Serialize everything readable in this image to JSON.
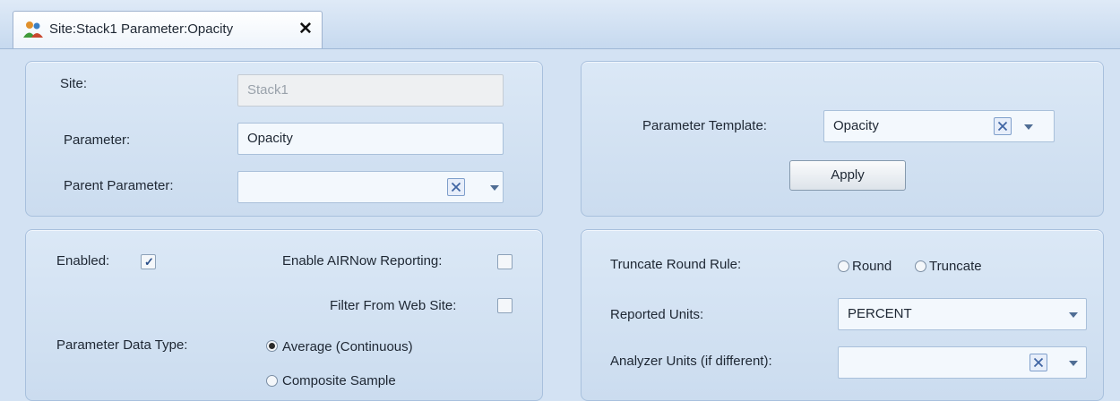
{
  "tab": {
    "title": "Site:Stack1 Parameter:Opacity",
    "close": "✕"
  },
  "identity": {
    "site_label": "Site:",
    "site_value": "Stack1",
    "parameter_label": "Parameter:",
    "parameter_value": "Opacity",
    "parent_label": "Parent Parameter:",
    "parent_value": ""
  },
  "template": {
    "label": "Parameter Template:",
    "value": "Opacity",
    "apply_label": "Apply"
  },
  "options": {
    "enabled_label": "Enabled:",
    "enabled_checked": true,
    "airnow_label": "Enable AIRNow Reporting:",
    "airnow_checked": false,
    "filter_label": "Filter From Web Site:",
    "filter_checked": false,
    "data_type_label": "Parameter Data Type:",
    "data_type_options": [
      "Average (Continuous)",
      "Composite Sample"
    ],
    "data_type_selected": "Average (Continuous)"
  },
  "units": {
    "truncate_label": "Truncate Round Rule:",
    "round_label": "Round",
    "truncate_option_label": "Truncate",
    "reported_label": "Reported Units:",
    "reported_value": "PERCENT",
    "analyzer_label": "Analyzer Units (if different):",
    "analyzer_value": ""
  },
  "colors": {
    "accent": "#4f6d94",
    "panel": "#d3e2f3"
  }
}
